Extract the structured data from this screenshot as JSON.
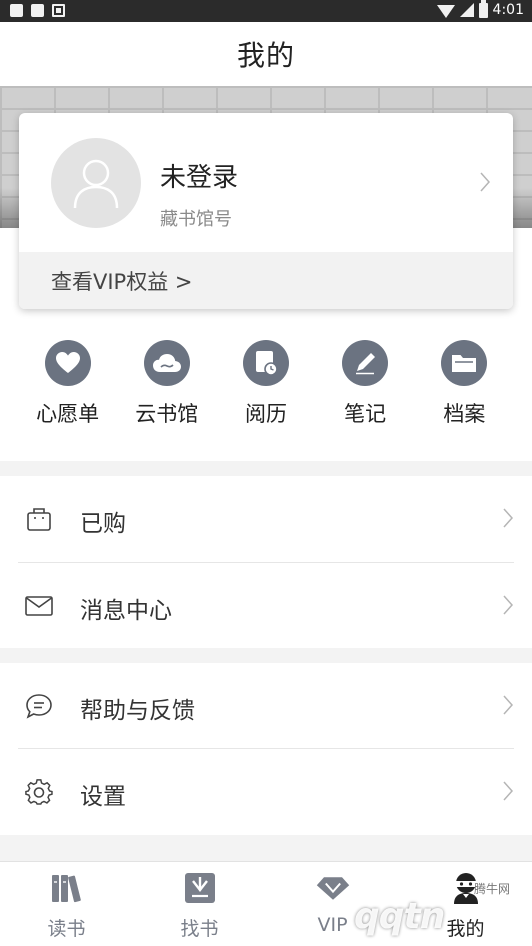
{
  "status_bar": {
    "time": "4:01"
  },
  "header": {
    "title": "我的"
  },
  "profile": {
    "name": "未登录",
    "library_id_label": "藏书馆号",
    "vip_link": "查看VIP权益 >"
  },
  "quick_actions": [
    {
      "label": "心愿单",
      "icon": "heart-icon"
    },
    {
      "label": "云书馆",
      "icon": "cloud-icon"
    },
    {
      "label": "阅历",
      "icon": "history-clock-icon"
    },
    {
      "label": "笔记",
      "icon": "pen-icon"
    },
    {
      "label": "档案",
      "icon": "folder-icon"
    }
  ],
  "menu": [
    {
      "label": "已购",
      "icon": "shopping-bag-icon"
    },
    {
      "label": "消息中心",
      "icon": "mail-icon"
    },
    {
      "label": "帮助与反馈",
      "icon": "chat-bubble-icon"
    },
    {
      "label": "设置",
      "icon": "gear-icon"
    }
  ],
  "bottom_nav": [
    {
      "label": "读书",
      "icon": "books-icon",
      "active": false
    },
    {
      "label": "找书",
      "icon": "bookmark-download-icon",
      "active": false
    },
    {
      "label": "VIP",
      "icon": "diamond-icon",
      "active": false
    },
    {
      "label": "我的",
      "icon": "user-avatar-icon",
      "active": true
    }
  ],
  "watermark": {
    "text": "腾牛网",
    "brand": "qqtn"
  },
  "colors": {
    "icon_gray": "#6b7381",
    "text_dark": "#222222",
    "text_muted": "#8a8a8a",
    "section_gap": "#f3f3f3"
  }
}
